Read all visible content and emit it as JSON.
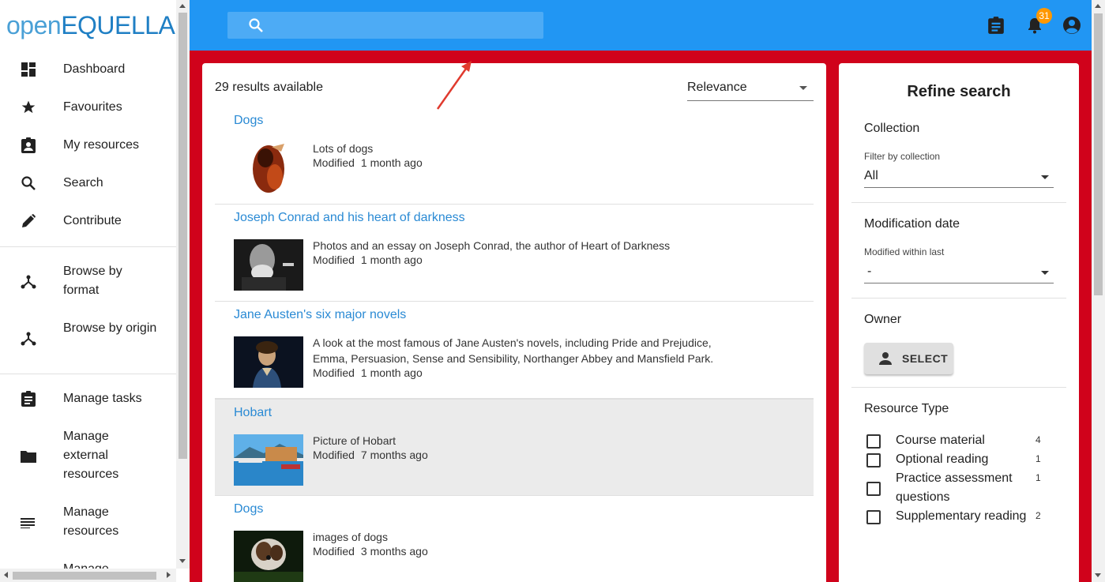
{
  "brand": {
    "logo_light": "open",
    "logo_bold": "EQUELLA"
  },
  "sidebar": {
    "items": [
      {
        "label": "Dashboard",
        "icon": "dashboard-icon"
      },
      {
        "label": "Favourites",
        "icon": "star-icon"
      },
      {
        "label": "My resources",
        "icon": "my-resources-icon"
      },
      {
        "label": "Search",
        "icon": "search-icon"
      },
      {
        "label": "Contribute",
        "icon": "pencil-icon"
      },
      {
        "label": "Browse by format",
        "icon": "hierarchy-icon"
      },
      {
        "label": "Browse by origin",
        "icon": "hierarchy-icon"
      },
      {
        "label": "Manage tasks",
        "icon": "clipboard-icon"
      },
      {
        "label": "Manage external resources",
        "icon": "folder-icon"
      },
      {
        "label": "Manage resources",
        "icon": "list-icon"
      },
      {
        "label": "Manage",
        "icon": ""
      }
    ]
  },
  "appbar": {
    "search_placeholder": "",
    "notification_count": "31",
    "icons": [
      "clipboard-icon",
      "bell-icon",
      "account-circle-icon"
    ]
  },
  "results": {
    "count_text": "29 results available",
    "sort": {
      "selected": "Relevance"
    },
    "modified_label": "Modified",
    "items": [
      {
        "title": "Dogs",
        "description": "Lots of dogs",
        "modified": "1 month ago"
      },
      {
        "title": "Joseph Conrad and his heart of darkness",
        "description": "Photos and an essay on Joseph Conrad, the author of Heart of Darkness",
        "modified": "1 month ago"
      },
      {
        "title": "Jane Austen's six major novels",
        "description": "A look at the most famous of Jane Austen's novels, including Pride and Prejudice, Emma, Persuasion, Sense and Sensibility, Northanger Abbey and Mansfield Park.",
        "modified": "1 month ago"
      },
      {
        "title": "Hobart",
        "description": "Picture of Hobart",
        "modified": "7 months ago"
      },
      {
        "title": "Dogs",
        "description": "images of dogs",
        "modified": "3 months ago"
      }
    ]
  },
  "refine": {
    "title": "Refine search",
    "collection": {
      "title": "Collection",
      "label": "Filter by collection",
      "value": "All"
    },
    "modification": {
      "title": "Modification date",
      "label": "Modified within last",
      "value": "-"
    },
    "owner": {
      "title": "Owner",
      "button": "SELECT"
    },
    "resource_type": {
      "title": "Resource Type",
      "options": [
        {
          "label": "Course material",
          "count": "4"
        },
        {
          "label": "Optional reading",
          "count": "1"
        },
        {
          "label": "Practice assessment questions",
          "count": "1"
        },
        {
          "label": "Supplementary reading",
          "count": "2"
        }
      ]
    }
  },
  "colors": {
    "appbar": "#2196f3",
    "main_background": "#d0021b",
    "link": "#2a8ad4",
    "badge": "#ff9800"
  }
}
